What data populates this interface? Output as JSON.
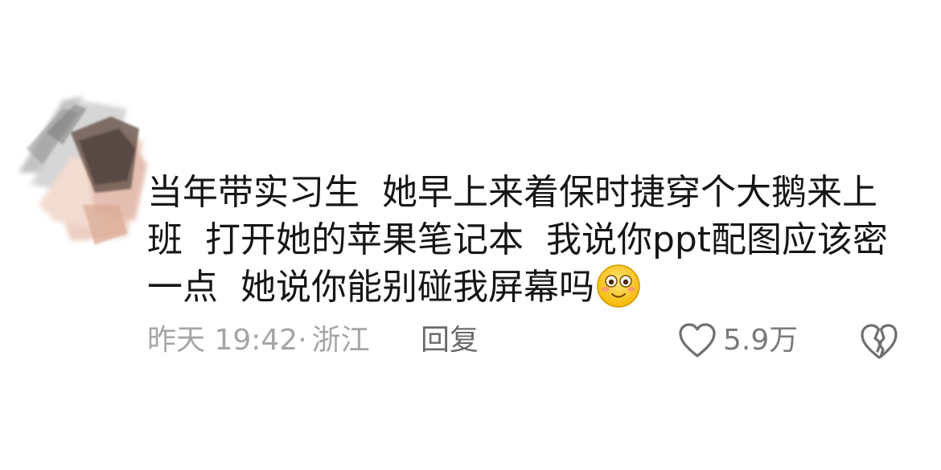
{
  "comment": {
    "text": "当年带实习生  她早上来着保时捷穿个大鹅来上班  打开她的苹果笔记本  我说你ppt配图应该密一点  她说你能别碰我屏幕吗",
    "emoji_icon": "blushing-smiley-face-icon"
  },
  "meta": {
    "time": "昨天 19:42",
    "separator": "·",
    "location": "浙江",
    "reply_label": "回复"
  },
  "actions": {
    "like_icon": "heart-outline-icon",
    "like_count": "5.9万",
    "dislike_icon": "broken-heart-outline-icon"
  },
  "colors": {
    "text": "#161616",
    "meta": "#a5a5a5",
    "reply": "#6b6b6b",
    "icon": "#6f6f6f"
  }
}
